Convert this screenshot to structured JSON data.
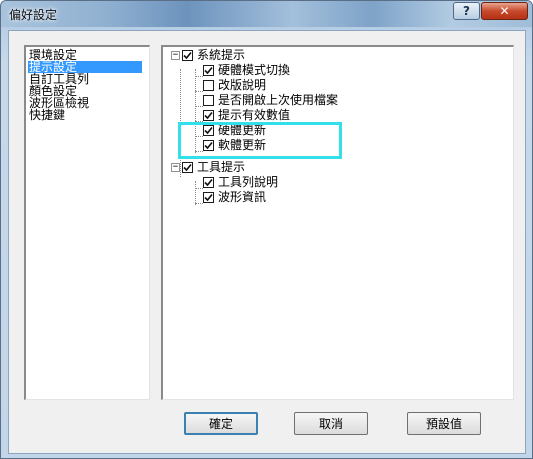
{
  "window": {
    "title": "偏好設定",
    "help_label": "?",
    "close_label": "✕"
  },
  "categories": [
    {
      "label": "環境設定",
      "selected": false
    },
    {
      "label": "提示設定",
      "selected": true
    },
    {
      "label": "自訂工具列",
      "selected": false
    },
    {
      "label": "顏色設定",
      "selected": false
    },
    {
      "label": "波形區檢視",
      "selected": false
    },
    {
      "label": "快捷鍵",
      "selected": false
    }
  ],
  "tree": {
    "system": {
      "label": "系統提示",
      "checked": true,
      "expanded": true,
      "expander": "−",
      "children": [
        {
          "label": "硬體模式切換",
          "checked": true
        },
        {
          "label": "改版說明",
          "checked": false
        },
        {
          "label": "是否開啟上次使用檔案",
          "checked": false
        },
        {
          "label": "提示有效數值",
          "checked": true
        },
        {
          "label": "硬體更新",
          "checked": true
        },
        {
          "label": "軟體更新",
          "checked": true
        }
      ]
    },
    "tools": {
      "label": "工具提示",
      "checked": true,
      "expanded": true,
      "expander": "−",
      "children": [
        {
          "label": "工具列說明",
          "checked": true
        },
        {
          "label": "波形資訊",
          "checked": true
        }
      ]
    }
  },
  "buttons": {
    "ok": "確定",
    "cancel": "取消",
    "defaults": "預設值"
  },
  "colors": {
    "selection": "#3399ff",
    "highlight_box": "#33e0e9",
    "close_button": "#c74a2e"
  }
}
